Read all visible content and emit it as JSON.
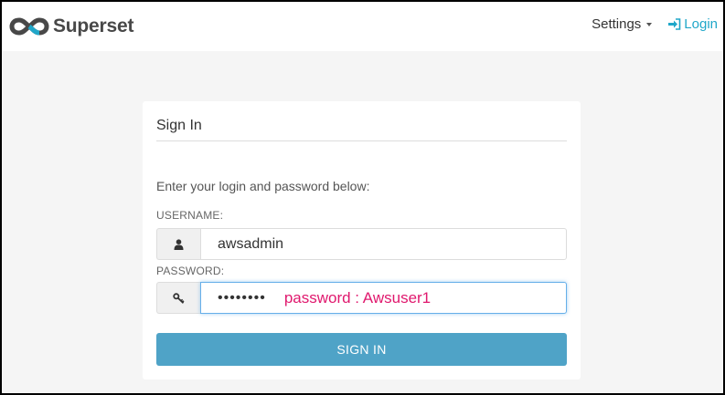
{
  "navbar": {
    "brand_name": "Superset",
    "settings_label": "Settings",
    "login_label": "Login",
    "accent_color": "#20a7c9"
  },
  "form": {
    "title": "Sign In",
    "instructions": "Enter your login and password below:",
    "username_label": "USERNAME:",
    "username_value": "awsadmin",
    "username_icon": "user-icon",
    "password_label": "PASSWORD:",
    "password_masked": "••••••••",
    "password_icon": "key-icon",
    "submit_label": "SIGN IN",
    "button_color": "#4fa3c7"
  },
  "annotation": {
    "text": "password : Awsuser1",
    "color": "#e0196e"
  }
}
